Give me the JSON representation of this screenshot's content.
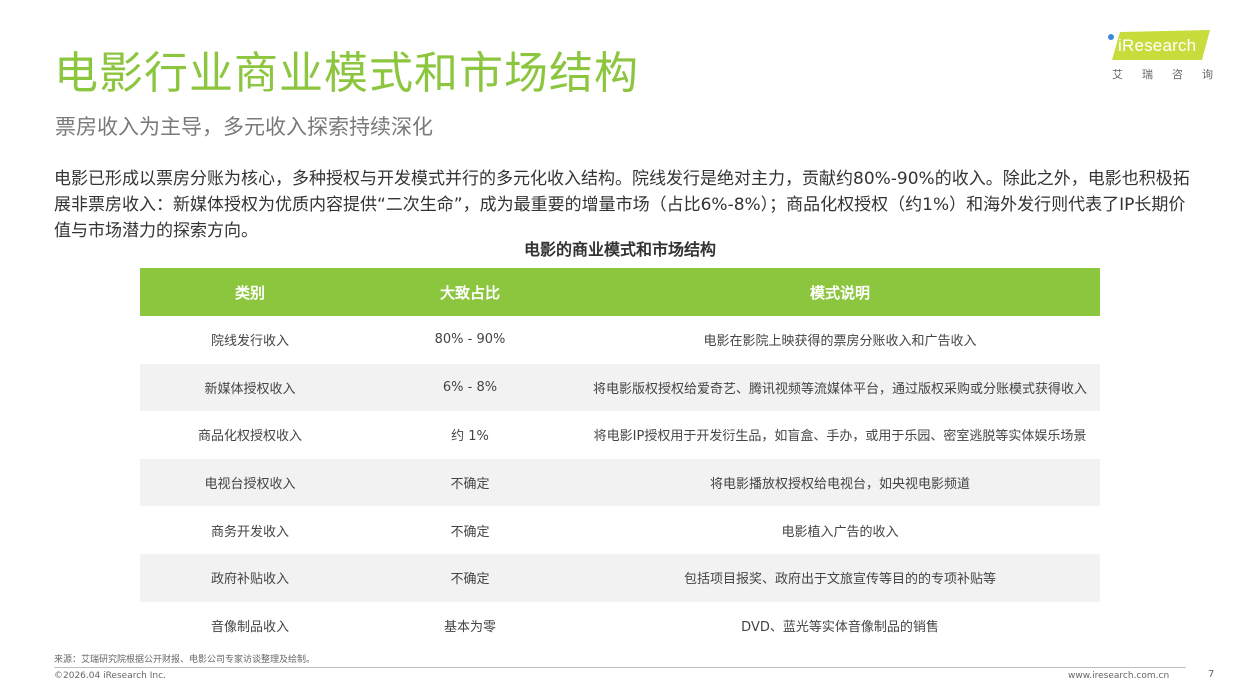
{
  "header": {
    "title": "电影行业商业模式和市场结构",
    "subtitle": "票房收入为主导，多元收入探索持续深化"
  },
  "logo": {
    "brand": "iResearch",
    "brand_cn": "艾瑞咨询",
    "colors": {
      "badge": "#c8dc3c",
      "dot": "#3a8dde"
    }
  },
  "intro": "电影已形成以票房分账为核心，多种授权与开发模式并行的多元化收入结构。院线发行是绝对主力，贡献约80%-90%的收入。除此之外，电影也积极拓展非票房收入：新媒体授权为优质内容提供“二次生命”，成为最重要的增量市场（占比6%-8%）；商品化权授权（约1%）和海外发行则代表了IP长期价值与市场潜力的探索方向。",
  "table": {
    "title": "电影的商业模式和市场结构",
    "headers": [
      "类别",
      "大致占比",
      "模式说明"
    ],
    "rows": [
      [
        "院线发行收入",
        "80% - 90%",
        "电影在影院上映获得的票房分账收入和广告收入"
      ],
      [
        "新媒体授权收入",
        "6% - 8%",
        "将电影版权授权给爱奇艺、腾讯视频等流媒体平台，通过版权采购或分账模式获得收入"
      ],
      [
        "商品化权授权收入",
        "约 1%",
        "将电影IP授权用于开发衍生品，如盲盒、手办，或用于乐园、密室逃脱等实体娱乐场景"
      ],
      [
        "电视台授权收入",
        "不确定",
        "将电影播放权授权给电视台，如央视电影频道"
      ],
      [
        "商务开发收入",
        "不确定",
        "电影植入广告的收入"
      ],
      [
        "政府补贴收入",
        "不确定",
        "包括项目报奖、政府出于文旅宣传等目的的专项补贴等"
      ],
      [
        "音像制品收入",
        "基本为零",
        "DVD、蓝光等实体音像制品的销售"
      ]
    ]
  },
  "footer": {
    "source": "来源：艾瑞研究院根据公开财报、电影公司专家访谈整理及绘制。",
    "copyright": "©2026.04 iResearch Inc.",
    "website": "www.iresearch.com.cn",
    "page": "7"
  },
  "theme": {
    "accent": "#8cc63f",
    "row_alt": "#f2f2f2"
  }
}
